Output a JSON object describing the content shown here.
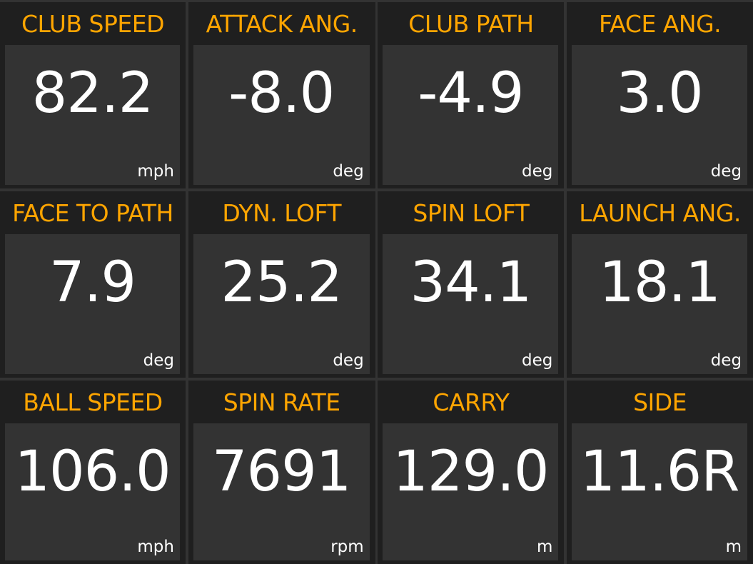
{
  "colors": {
    "label": "#ffa500",
    "value": "#ffffff",
    "tile_bg": "#1f1f1f",
    "panel_bg": "#333333"
  },
  "metrics": [
    {
      "label": "CLUB SPEED",
      "value": "82.2",
      "unit": "mph"
    },
    {
      "label": "ATTACK ANG.",
      "value": "-8.0",
      "unit": "deg"
    },
    {
      "label": "CLUB PATH",
      "value": "-4.9",
      "unit": "deg"
    },
    {
      "label": "FACE ANG.",
      "value": "3.0",
      "unit": "deg"
    },
    {
      "label": "FACE TO PATH",
      "value": "7.9",
      "unit": "deg"
    },
    {
      "label": "DYN. LOFT",
      "value": "25.2",
      "unit": "deg"
    },
    {
      "label": "SPIN LOFT",
      "value": "34.1",
      "unit": "deg"
    },
    {
      "label": "LAUNCH ANG.",
      "value": "18.1",
      "unit": "deg"
    },
    {
      "label": "BALL SPEED",
      "value": "106.0",
      "unit": "mph"
    },
    {
      "label": "SPIN RATE",
      "value": "7691",
      "unit": "rpm"
    },
    {
      "label": "CARRY",
      "value": "129.0",
      "unit": "m"
    },
    {
      "label": "SIDE",
      "value": "11.6R",
      "unit": "m"
    }
  ]
}
